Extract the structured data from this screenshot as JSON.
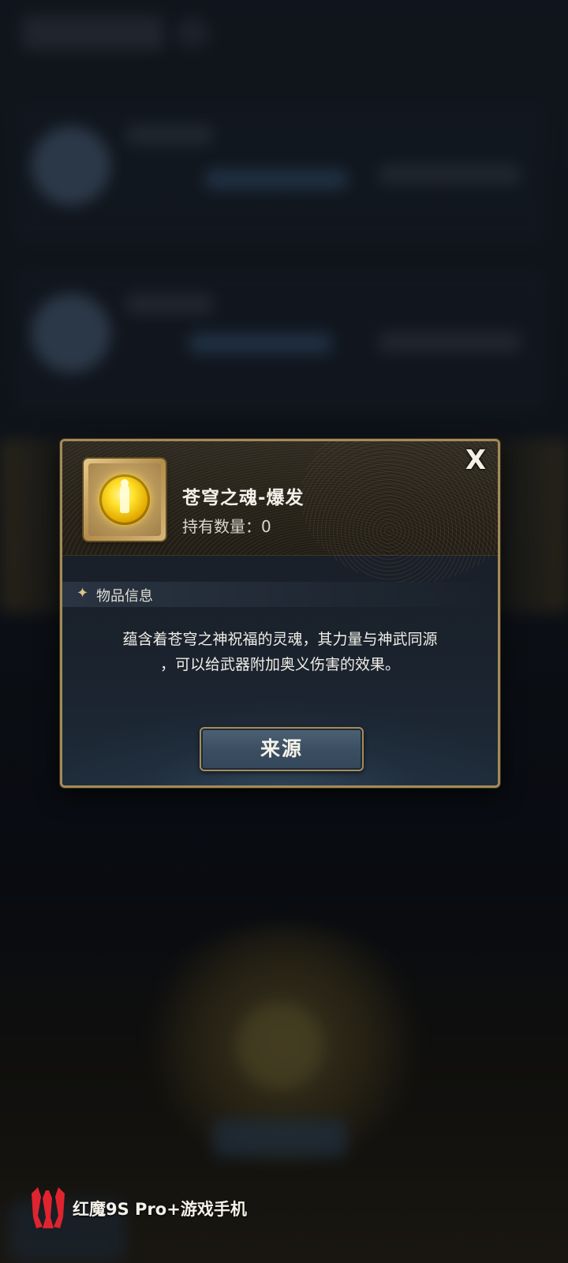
{
  "item": {
    "name": "苍穹之魂-爆发",
    "count_text": "持有数量：0",
    "icon": "golden-soul-orb"
  },
  "close_label": "X",
  "section": {
    "icon": "sparkle",
    "title": "物品信息"
  },
  "description": {
    "line1": "蕴含着苍穹之神祝福的灵魂，其力量与神武同源",
    "line2": "，可以给武器附加奥义伤害的效果。"
  },
  "source_button": {
    "label": "来源"
  },
  "watermark": {
    "logo": "red-magic-logo",
    "text": "红魔9S Pro+游戏手机"
  },
  "colors": {
    "frame_gold": "#a38b58",
    "button_blue": "#3c4f62",
    "watermark_red": "#e0242f"
  }
}
